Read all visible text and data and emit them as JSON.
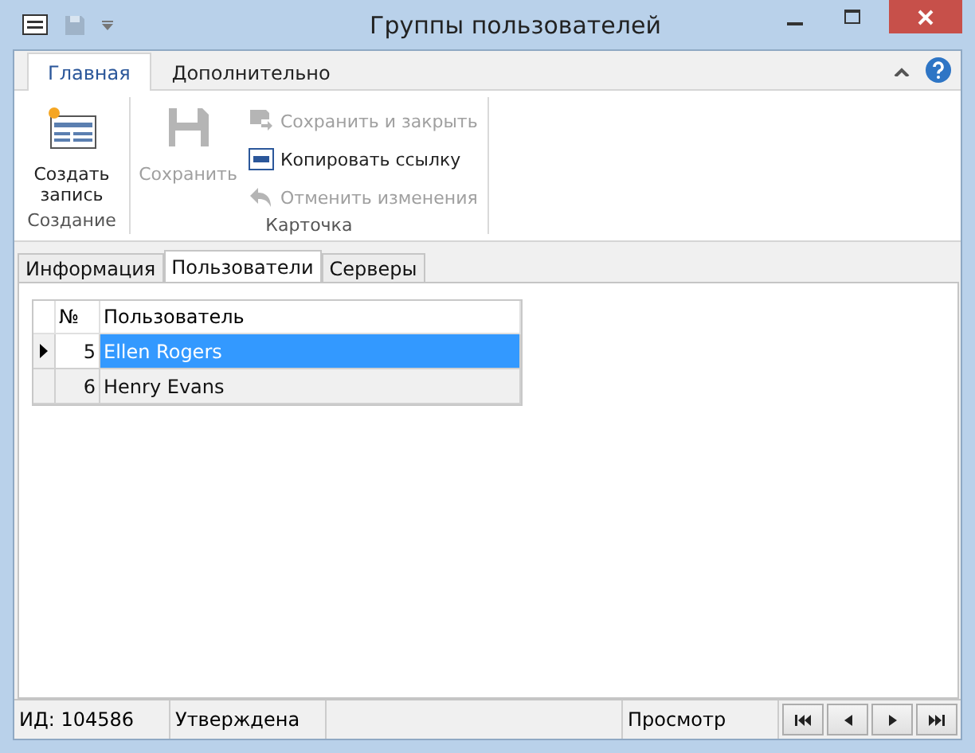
{
  "window": {
    "title": "Группы пользователей"
  },
  "ribbon_tabs": [
    {
      "label": "Главная",
      "selected": true
    },
    {
      "label": "Дополнительно",
      "selected": false
    }
  ],
  "ribbon_groups": [
    {
      "caption": "Создание",
      "buttons": [
        {
          "kind": "large",
          "label": "Создать запись",
          "disabled": false
        }
      ]
    },
    {
      "caption": "Карточка",
      "buttons": [
        {
          "kind": "large",
          "label": "Сохранить",
          "disabled": true
        },
        {
          "kind": "small",
          "label": "Сохранить и закрыть",
          "disabled": true
        },
        {
          "kind": "small",
          "label": "Копировать ссылку",
          "disabled": false
        },
        {
          "kind": "small",
          "label": "Отменить изменения",
          "disabled": true
        }
      ]
    }
  ],
  "tabs": [
    {
      "label": "Информация",
      "selected": false
    },
    {
      "label": "Пользователи",
      "selected": true
    },
    {
      "label": "Серверы",
      "selected": false
    }
  ],
  "table": {
    "columns": [
      "№",
      "Пользователь"
    ],
    "rows": [
      {
        "cells": [
          "5",
          "Ellen Rogers"
        ],
        "selected": true
      },
      {
        "cells": [
          "6",
          "Henry Evans"
        ],
        "selected": false
      }
    ]
  },
  "status_bar": {
    "id": "ИД: 104586",
    "state": "Утверждена",
    "mode": "Просмотр"
  }
}
